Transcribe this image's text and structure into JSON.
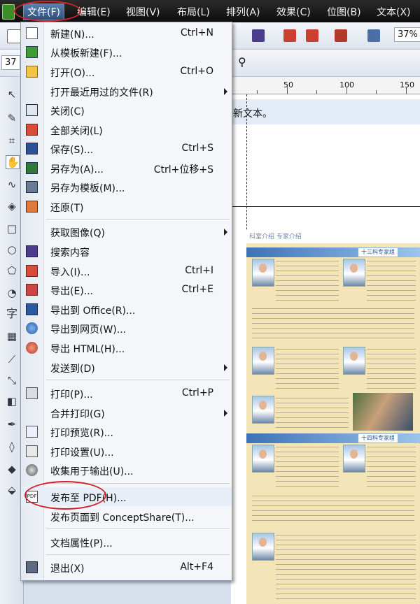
{
  "menubar": {
    "items": [
      "文件(F)",
      "编辑(E)",
      "视图(V)",
      "布局(L)",
      "排列(A)",
      "效果(C)",
      "位图(B)",
      "文本(X)"
    ]
  },
  "toolbar": {
    "zoom_value": "37%",
    "zoom_value_left": "37"
  },
  "ruler": {
    "labels": [
      "50",
      "100",
      "150"
    ]
  },
  "canvas": {
    "new_text_label": "新文本。"
  },
  "toolbox": {
    "text_tool_glyph": "字"
  },
  "document": {
    "header_text": "科室介绍 专家介绍",
    "band1_title": "十三科专家组",
    "band2_title": "十四科专家组"
  },
  "file_menu": {
    "items": [
      {
        "label": "新建(N)...",
        "shortcut": "Ctrl+N",
        "icon": "new-document-icon"
      },
      {
        "label": "从模板新建(F)...",
        "shortcut": "",
        "icon": "new-from-template-icon"
      },
      {
        "label": "打开(O)...",
        "shortcut": "Ctrl+O",
        "icon": "open-folder-icon"
      },
      {
        "label": "打开最近用过的文件(R)",
        "shortcut": "",
        "icon": "",
        "submenu": true
      },
      {
        "label": "关闭(C)",
        "shortcut": "",
        "icon": "close-document-icon"
      },
      {
        "label": "全部关闭(L)",
        "shortcut": "",
        "icon": "close-all-icon"
      },
      {
        "label": "保存(S)...",
        "shortcut": "Ctrl+S",
        "icon": "save-disk-icon"
      },
      {
        "label": "另存为(A)...",
        "shortcut": "Ctrl+位移+S",
        "icon": "save-as-icon"
      },
      {
        "label": "另存为模板(M)...",
        "shortcut": "",
        "icon": "save-template-icon"
      },
      {
        "label": "还原(T)",
        "shortcut": "",
        "icon": "revert-icon"
      },
      {
        "label": "获取图像(Q)",
        "shortcut": "",
        "icon": "",
        "submenu": true
      },
      {
        "label": "搜索内容",
        "shortcut": "",
        "icon": "search-content-icon"
      },
      {
        "label": "导入(I)...",
        "shortcut": "Ctrl+I",
        "icon": "import-icon"
      },
      {
        "label": "导出(E)...",
        "shortcut": "Ctrl+E",
        "icon": "export-icon"
      },
      {
        "label": "导出到 Office(R)...",
        "shortcut": "",
        "icon": "export-office-icon"
      },
      {
        "label": "导出到网页(W)...",
        "shortcut": "",
        "icon": "export-web-icon"
      },
      {
        "label": "导出 HTML(H)...",
        "shortcut": "",
        "icon": "export-html-icon"
      },
      {
        "label": "发送到(D)",
        "shortcut": "",
        "icon": "",
        "submenu": true
      },
      {
        "label": "打印(P)...",
        "shortcut": "Ctrl+P",
        "icon": "print-icon"
      },
      {
        "label": "合并打印(G)",
        "shortcut": "",
        "icon": "",
        "submenu": true
      },
      {
        "label": "打印预览(R)...",
        "shortcut": "",
        "icon": "print-preview-icon"
      },
      {
        "label": "打印设置(U)...",
        "shortcut": "",
        "icon": "print-setup-icon"
      },
      {
        "label": "收集用于输出(U)...",
        "shortcut": "",
        "icon": "collect-output-icon"
      },
      {
        "label": "发布至 PDF(H)...",
        "shortcut": "",
        "icon": "pdf-icon"
      },
      {
        "label": "发布页面到 ConceptShare(T)...",
        "shortcut": "",
        "icon": ""
      },
      {
        "label": "文档属性(P)...",
        "shortcut": "",
        "icon": ""
      },
      {
        "label": "退出(X)",
        "shortcut": "Alt+F4",
        "icon": "exit-icon"
      }
    ]
  },
  "colors": {
    "highlight_circle": "#d4202a",
    "menubar_bg": "#1a1a1a",
    "menu_bg": "#f4f6f9"
  }
}
